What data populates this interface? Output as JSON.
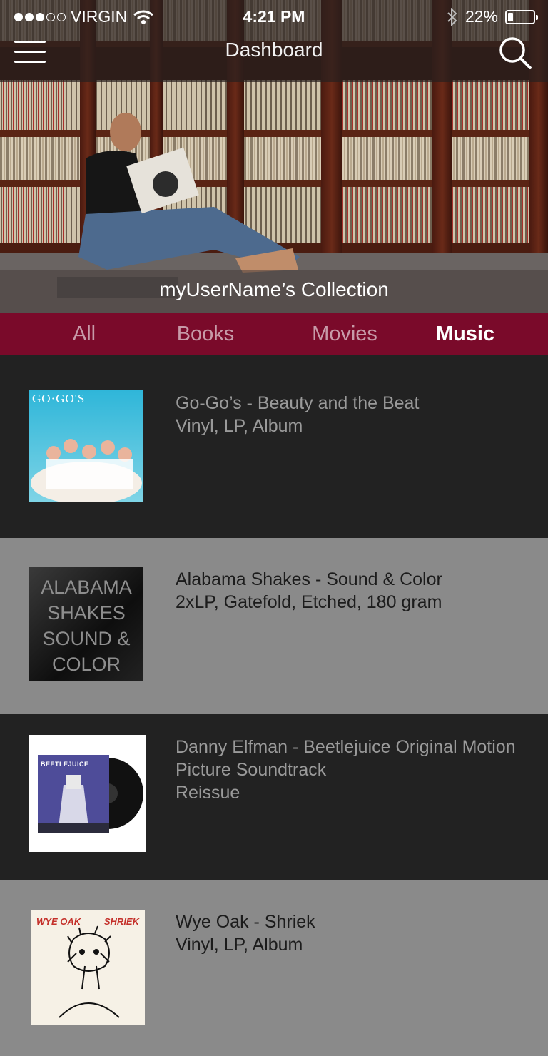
{
  "status_bar": {
    "signal_bars_filled": 3,
    "signal_bars_total": 5,
    "carrier": "VIRGIN",
    "time": "4:21 PM",
    "battery": "22%",
    "battery_level": 0.22
  },
  "header": {
    "title": "Dashboard",
    "menu_icon": "hamburger-menu-icon",
    "search_icon": "search-icon"
  },
  "hero": {
    "caption": "myUserName’s Collection"
  },
  "tabs": [
    {
      "label": "All",
      "active": false
    },
    {
      "label": "Books",
      "active": false
    },
    {
      "label": "Movies",
      "active": false
    },
    {
      "label": "Music",
      "active": true
    }
  ],
  "items": [
    {
      "lines": [
        "Go-Go’s - Beauty and the Beat",
        "Vinyl, LP, Album"
      ],
      "cover_text": [
        "GO·GO'S"
      ]
    },
    {
      "lines": [
        "Alabama Shakes - Sound & Color",
        "2xLP, Gatefold, Etched, 180 gram"
      ],
      "cover_text": [
        "ALABAMA",
        "SHAKES",
        "SOUND &",
        "COLOR"
      ]
    },
    {
      "lines": [
        "Danny Elfman - Beetlejuice Original Motion",
        "Picture Soundtrack",
        "Reissue"
      ],
      "cover_text": [
        "BEETLEJUICE"
      ]
    },
    {
      "lines": [
        "Wye Oak - Shriek",
        "Vinyl, LP, Album"
      ],
      "cover_text": [
        "WYE OAK",
        "SHRIEK"
      ]
    }
  ],
  "colors": {
    "tab_bar": "#7a0a2a",
    "row_dark": "#222222",
    "row_light": "#8a8a8a"
  }
}
